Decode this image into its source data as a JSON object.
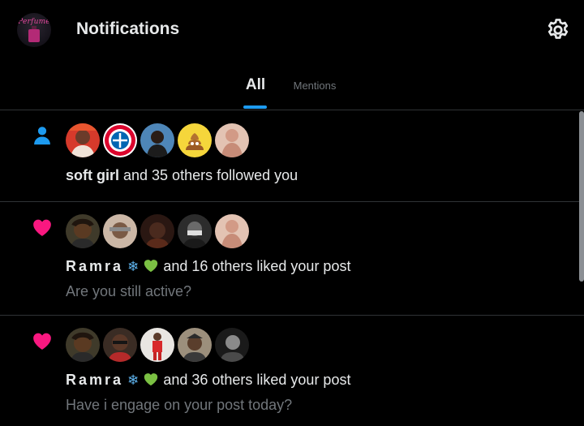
{
  "header": {
    "avatar_logo_text": "Perfume",
    "title": "Notifications",
    "settings_icon": "gear-icon"
  },
  "tabs": [
    {
      "label": "All",
      "active": true
    },
    {
      "label": "Mentions",
      "active": false
    }
  ],
  "colors": {
    "accent": "#1d9bf0",
    "like": "#f91880",
    "follow": "#1d9bf0",
    "muted_text": "#71767b",
    "divider": "#2f3336"
  },
  "notifications": [
    {
      "type": "follow",
      "icon": "person-icon",
      "actor": "soft girl",
      "action": " and 35 others followed you",
      "subtext": ""
    },
    {
      "type": "like",
      "icon": "heart-icon",
      "actor": "Ramra",
      "actor_emojis": [
        "snowflake",
        "green-heart"
      ],
      "action": " and 16 others liked your post",
      "subtext": "Are you still active?"
    },
    {
      "type": "like",
      "icon": "heart-icon",
      "actor": "Ramra",
      "actor_emojis": [
        "snowflake",
        "green-heart"
      ],
      "action": " and 36 others liked your post",
      "subtext": "Have i engage on your post today?"
    }
  ],
  "snowflake_glyph": "❄"
}
